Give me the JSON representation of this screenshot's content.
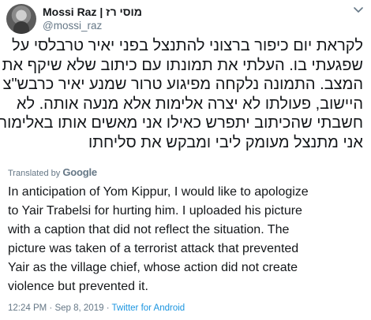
{
  "tweet": {
    "author": {
      "display_name": "Mossi Raz | מוסי רז",
      "handle": "@mossi_raz"
    },
    "original_lines": [
      "לקראת יום כיפור ברצוני להתנצל בפני יאיר טרבלסי על",
      "שפגעתי בו. העלתי את תמונתו עם כיתוב שלא שיקף את",
      "המצב. התמונה נלקחה מפיגוע טרור שמנע יאיר כרבש\"צ",
      "היישוב, פעולתו לא יצרה אלימות אלא מנעה אותה. לא",
      "חשבתי שהכיתוב יתפרש כאילו אני מאשים אותו באלימות.",
      "אני מתנצל מעומק ליבי ומבקש את סליחתו"
    ],
    "translation": {
      "label": "Translated by",
      "provider": "Google",
      "lines": [
        "In anticipation of Yom Kippur, I would like to apologize",
        "to Yair Trabelsi for hurting him. I uploaded his picture",
        "with a caption that did not reflect the situation. The",
        "picture was taken of a terrorist attack that prevented",
        "Yair as the village chief, whose action did not create",
        "violence but prevented it."
      ]
    },
    "meta": {
      "time": "12:24 PM",
      "separator1": " · ",
      "date": "Sep 8, 2019",
      "separator2": " · ",
      "source": "Twitter for Android"
    }
  }
}
